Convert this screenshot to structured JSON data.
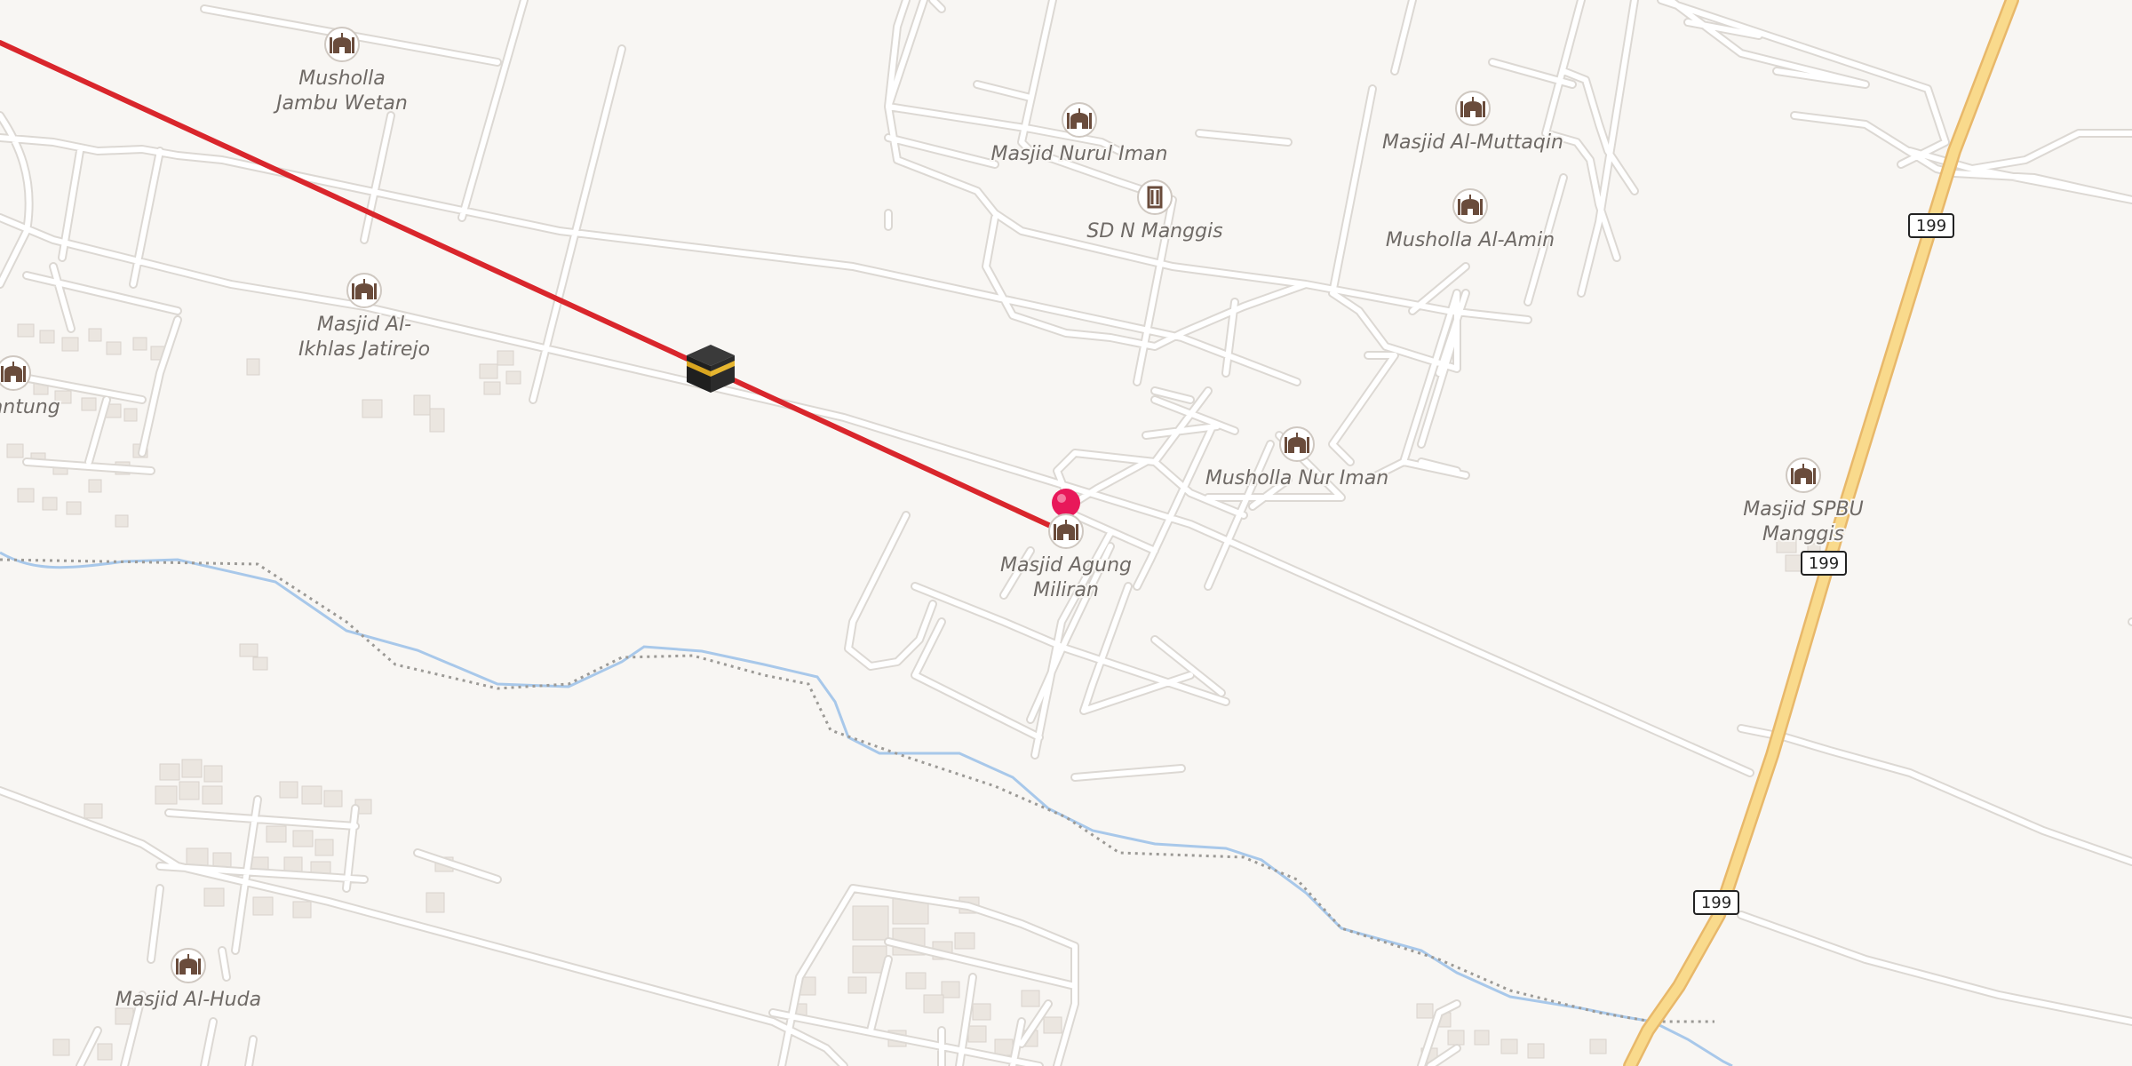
{
  "map": {
    "colors": {
      "background": "#f8f6f3",
      "road_minor": "#ffffff",
      "road_casing": "#dcd8d3",
      "road_primary": "#f9da8c",
      "road_primary_casing": "#e8b86a",
      "river": "#a8c8ea",
      "rail": "#9c9a96",
      "building": "#ebe6e0",
      "building_outline": "#d9d3cc",
      "qibla_line": "#d9262c",
      "pin": "#e8185a",
      "poi_icon": "#6a4c3c"
    },
    "qibla_line": {
      "icon": "kaaba-icon"
    },
    "current_location": {
      "icon": "location-pin-icon"
    },
    "road_shields": [
      {
        "number": "199"
      },
      {
        "number": "199"
      },
      {
        "number": "199"
      }
    ],
    "pois": [
      {
        "name": "Musholla Jambu Wetan",
        "lines": [
          "Musholla",
          "Jambu Wetan"
        ],
        "icon": "mosque-icon"
      },
      {
        "name": "Masjid Nurul Iman",
        "lines": [
          "Masjid Nurul Iman"
        ],
        "icon": "mosque-icon"
      },
      {
        "name": "SD N Manggis",
        "lines": [
          "SD N Manggis"
        ],
        "icon": "school-icon"
      },
      {
        "name": "Masjid Al-Muttaqin",
        "lines": [
          "Masjid Al-Muttaqin"
        ],
        "icon": "mosque-icon"
      },
      {
        "name": "Musholla Al-Amin",
        "lines": [
          "Musholla Al-Amin"
        ],
        "icon": "mosque-icon"
      },
      {
        "name": "Masjid Al-Ikhlas Jatirejo",
        "lines": [
          "Masjid Al-",
          "Ikhlas Jatirejo"
        ],
        "icon": "mosque-icon"
      },
      {
        "name": "Masjid Jantung",
        "lines": [
          "d Jantung"
        ],
        "icon": "mosque-icon"
      },
      {
        "name": "Musholla Nur Iman",
        "lines": [
          "Musholla Nur Iman"
        ],
        "icon": "mosque-icon"
      },
      {
        "name": "Masjid Agung Miliran",
        "lines": [
          "Masjid Agung",
          "Miliran"
        ],
        "icon": "mosque-icon"
      },
      {
        "name": "Masjid SPBU Manggis",
        "lines": [
          "Masjid SPBU",
          "Manggis"
        ],
        "icon": "mosque-icon"
      },
      {
        "name": "Masjid Al-Huda",
        "lines": [
          "Masjid Al-Huda"
        ],
        "icon": "mosque-icon"
      }
    ]
  }
}
